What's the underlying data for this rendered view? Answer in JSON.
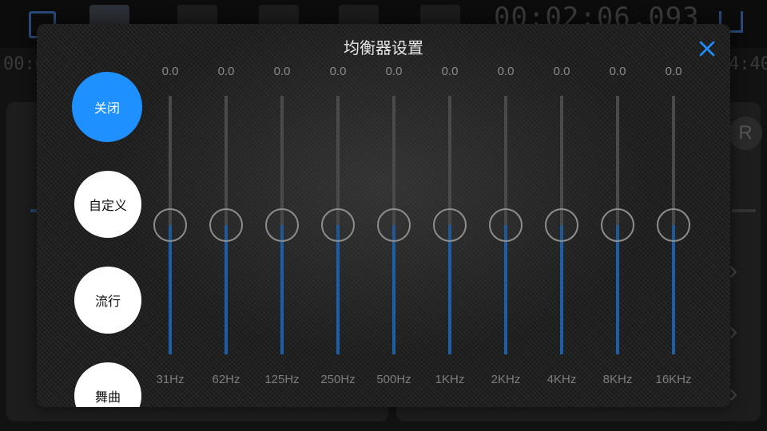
{
  "background": {
    "time_display": "00:02:06.093",
    "time_left": "00:0",
    "time_right": "4:40",
    "right_badge": "R"
  },
  "dialog": {
    "title": "均衡器设置",
    "close_icon": "close-icon",
    "accent_color": "#1e90ff"
  },
  "presets": [
    {
      "label": "关闭",
      "active": true
    },
    {
      "label": "自定义",
      "active": false
    },
    {
      "label": "流行",
      "active": false
    },
    {
      "label": "舞曲",
      "active": false
    }
  ],
  "equalizer": {
    "level_fraction": 0.5,
    "bands": [
      {
        "freq": "31Hz",
        "value": "0.0"
      },
      {
        "freq": "62Hz",
        "value": "0.0"
      },
      {
        "freq": "125Hz",
        "value": "0.0"
      },
      {
        "freq": "250Hz",
        "value": "0.0"
      },
      {
        "freq": "500Hz",
        "value": "0.0"
      },
      {
        "freq": "1KHz",
        "value": "0.0"
      },
      {
        "freq": "2KHz",
        "value": "0.0"
      },
      {
        "freq": "4KHz",
        "value": "0.0"
      },
      {
        "freq": "8KHz",
        "value": "0.0"
      },
      {
        "freq": "16KHz",
        "value": "0.0"
      }
    ]
  }
}
